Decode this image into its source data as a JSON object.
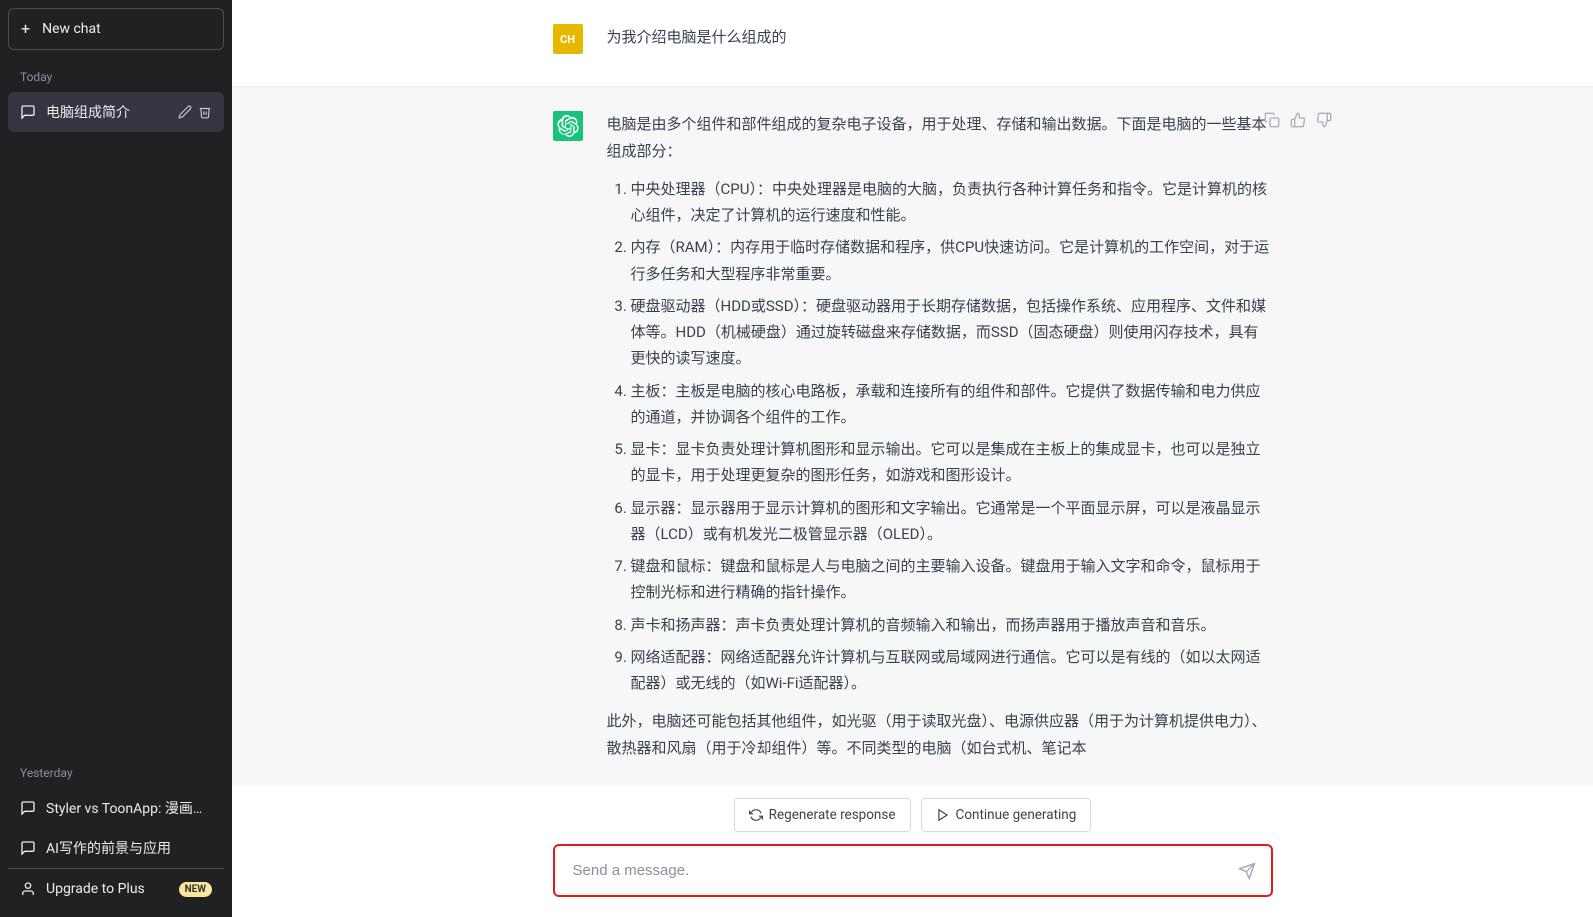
{
  "sidebar": {
    "new_chat_label": "New chat",
    "today_label": "Today",
    "yesterday_label": "Yesterday",
    "today_items": [
      {
        "title": "电脑组成简介",
        "active": true
      }
    ],
    "yesterday_items": [
      {
        "title": "Styler vs ToonApp: 漫画脸优势"
      },
      {
        "title": "AI写作的前景与应用"
      }
    ],
    "upgrade_label": "Upgrade to Plus",
    "upgrade_badge": "NEW"
  },
  "conversation": {
    "user_avatar_text": "CH",
    "user_message": "为我介绍电脑是什么组成的",
    "assistant_intro": "电脑是由多个组件和部件组成的复杂电子设备，用于处理、存储和输出数据。下面是电脑的一些基本组成部分：",
    "assistant_list": [
      "中央处理器（CPU）：中央处理器是电脑的大脑，负责执行各种计算任务和指令。它是计算机的核心组件，决定了计算机的运行速度和性能。",
      "内存（RAM）：内存用于临时存储数据和程序，供CPU快速访问。它是计算机的工作空间，对于运行多任务和大型程序非常重要。",
      "硬盘驱动器（HDD或SSD）：硬盘驱动器用于长期存储数据，包括操作系统、应用程序、文件和媒体等。HDD（机械硬盘）通过旋转磁盘来存储数据，而SSD（固态硬盘）则使用闪存技术，具有更快的读写速度。",
      "主板：主板是电脑的核心电路板，承载和连接所有的组件和部件。它提供了数据传输和电力供应的通道，并协调各个组件的工作。",
      "显卡：显卡负责处理计算机图形和显示输出。它可以是集成在主板上的集成显卡，也可以是独立的显卡，用于处理更复杂的图形任务，如游戏和图形设计。",
      "显示器：显示器用于显示计算机的图形和文字输出。它通常是一个平面显示屏，可以是液晶显示器（LCD）或有机发光二极管显示器（OLED）。",
      "键盘和鼠标：键盘和鼠标是人与电脑之间的主要输入设备。键盘用于输入文字和命令，鼠标用于控制光标和进行精确的指针操作。",
      "声卡和扬声器：声卡负责处理计算机的音频输入和输出，而扬声器用于播放声音和音乐。",
      "网络适配器：网络适配器允许计算机与互联网或局域网进行通信。它可以是有线的（如以太网适配器）或无线的（如Wi-Fi适配器）。"
    ],
    "assistant_outro": "此外，电脑还可能包括其他组件，如光驱（用于读取光盘）、电源供应器（用于为计算机提供电力）、散热器和风扇（用于冷却组件）等。不同类型的电脑（如台式机、笔记本"
  },
  "buttons": {
    "regenerate": "Regenerate response",
    "continue": "Continue generating"
  },
  "input": {
    "placeholder": "Send a message."
  }
}
